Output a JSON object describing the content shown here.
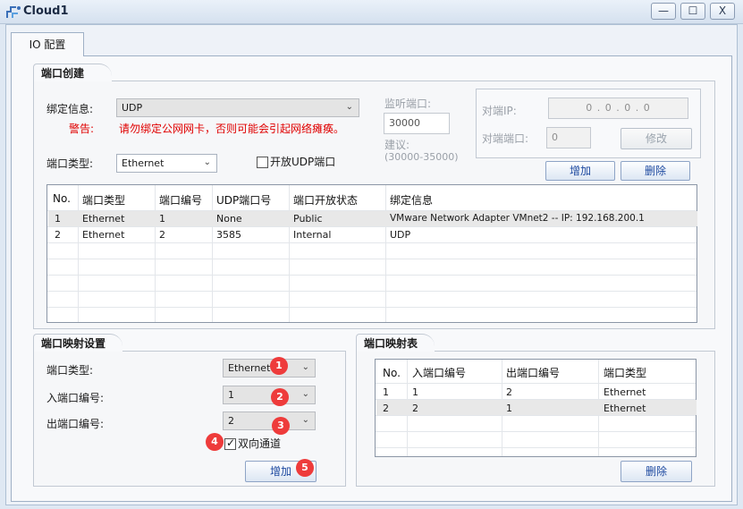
{
  "window": {
    "title": "Cloud1"
  },
  "tab": {
    "label": "IO 配置"
  },
  "creation": {
    "title": "端口创建",
    "bind_label": "绑定信息:",
    "bind_value": "UDP",
    "warning_label": "警告:",
    "warning_text": "请勿绑定公网网卡，否则可能会引起网络瘫痪。",
    "port_type_label": "端口类型:",
    "port_type_value": "Ethernet",
    "open_udp_label": "开放UDP端口",
    "listen_label": "监听端口:",
    "listen_value": "30000",
    "suggest_label": "建议:",
    "suggest_value": "(30000-35000)",
    "peer_ip_label": "对端IP:",
    "peer_ip_value": "0 . 0 . 0 . 0",
    "peer_port_label": "对端端口:",
    "peer_port_value": "0",
    "modify_label": "修改",
    "add_label": "增加",
    "delete_label": "删除",
    "headers": [
      "No.",
      "端口类型",
      "端口编号",
      "UDP端口号",
      "端口开放状态",
      "绑定信息"
    ],
    "rows": [
      [
        "1",
        "Ethernet",
        "1",
        "None",
        "Public",
        "VMware Network Adapter VMnet2 -- IP: 192.168.200.1"
      ],
      [
        "2",
        "Ethernet",
        "2",
        "3585",
        "Internal",
        "UDP"
      ]
    ]
  },
  "mapping": {
    "title": "端口映射设置",
    "type_label": "端口类型:",
    "type_value": "Ethernet",
    "in_label": "入端口编号:",
    "in_value": "1",
    "out_label": "出端口编号:",
    "out_value": "2",
    "bidirectional_label": "双向通道",
    "add_label": "增加",
    "badges": [
      "1",
      "2",
      "3",
      "4",
      "5"
    ]
  },
  "map_table": {
    "title": "端口映射表",
    "headers": [
      "No.",
      "入端口编号",
      "出端口编号",
      "端口类型"
    ],
    "rows": [
      [
        "1",
        "1",
        "2",
        "Ethernet"
      ],
      [
        "2",
        "2",
        "1",
        "Ethernet"
      ]
    ],
    "delete_label": "删除"
  },
  "controls": {
    "minimize": "—",
    "maximize": "☐",
    "close": "X"
  }
}
